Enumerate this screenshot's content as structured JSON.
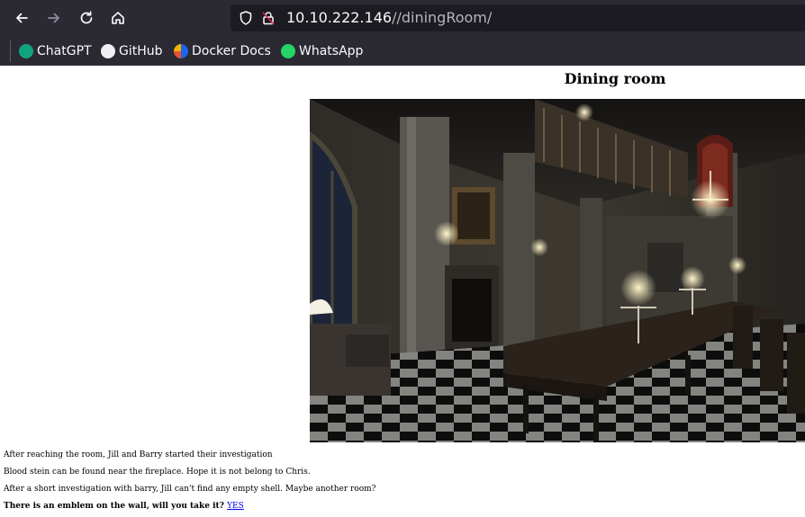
{
  "browser": {
    "url_host": "10.10.222.146",
    "url_path": "//diningRoom/",
    "bookmarks": [
      {
        "label": "ChatGPT",
        "icon": "chatgpt-icon"
      },
      {
        "label": "GitHub",
        "icon": "github-icon"
      },
      {
        "label": "Docker Docs",
        "icon": "docker-icon"
      },
      {
        "label": "WhatsApp",
        "icon": "whatsapp-icon"
      }
    ]
  },
  "page": {
    "title": "Dining room",
    "image_subject": "dining-room-scene",
    "lines": [
      "After reaching the room, Jill and Barry started their investigation",
      "Blood stein can be found near the fireplace. Hope it is not belong to Chris.",
      "After a short investigation with barry, Jill can't find any empty shell. Maybe another room?"
    ],
    "question": "There is an emblem on the wall, will you take it?",
    "link_label": "YES"
  },
  "colors": {
    "chrome_bg": "#2b2a33",
    "urlbar_bg": "#1c1b22",
    "link": "#0000ee"
  }
}
